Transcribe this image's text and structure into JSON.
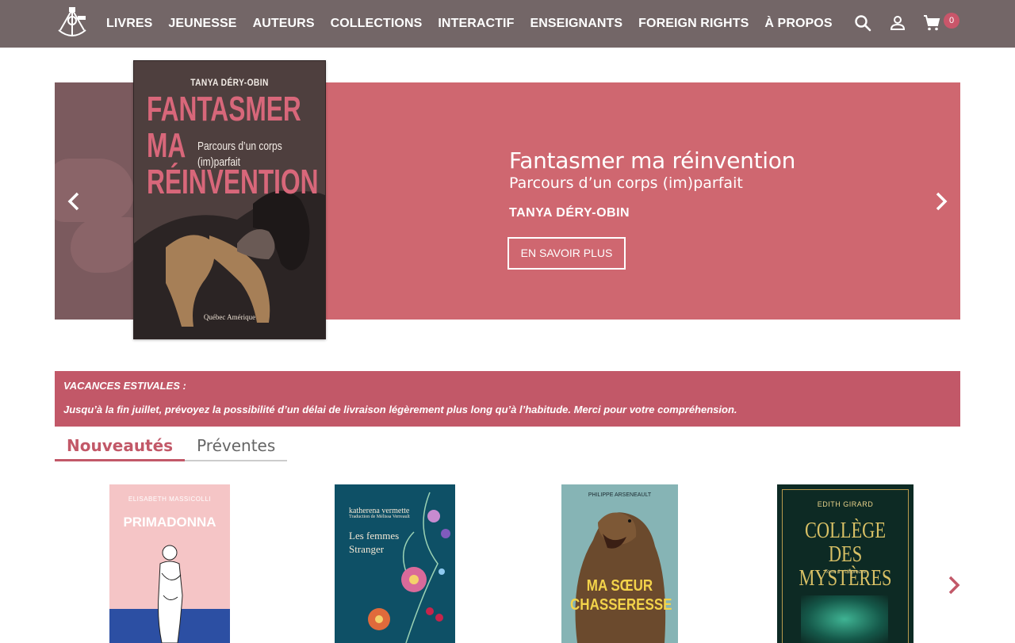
{
  "nav": {
    "items": [
      {
        "label": "LIVRES",
        "name": "nav-item-livres"
      },
      {
        "label": "JEUNESSE",
        "name": "nav-item-jeunesse"
      },
      {
        "label": "AUTEURS",
        "name": "nav-item-auteurs"
      },
      {
        "label": "COLLECTIONS",
        "name": "nav-item-collections"
      },
      {
        "label": "INTERACTIF",
        "name": "nav-item-interactif"
      },
      {
        "label": "ENSEIGNANTS",
        "name": "nav-item-enseignants"
      },
      {
        "label": "FOREIGN RIGHTS",
        "name": "nav-item-foreign-rights"
      },
      {
        "label": "À PROPOS",
        "name": "nav-item-a-propos"
      }
    ],
    "cart_count": "0"
  },
  "hero": {
    "title": "Fantasmer ma réinvention",
    "subtitle": "Parcours d’un corps (im)parfait",
    "author": "TANYA DÉRY-OBIN",
    "button_label": "EN SAVOIR PLUS",
    "cover": {
      "author": "TANYA DÉRY-OBIN",
      "title": "FANTASMER\nMA\nRÉINVENTION",
      "subtitle": "Parcours d’un corps\n(im)parfait",
      "publisher": "Québec Amérique"
    }
  },
  "notice": {
    "title": "VACANCES ESTIVALES :",
    "text": "Jusqu’à la fin juillet, prévoyez la possibilité d’un délai de livraison légèrement plus long qu’à l’habitude. Merci pour votre compréhension."
  },
  "tabs": [
    {
      "label": "Nouveautés",
      "active": true
    },
    {
      "label": "Préventes",
      "active": false
    }
  ],
  "books": [
    {
      "author": "ELISABETH MASSICOLLI",
      "title": "PRIMADONNA"
    },
    {
      "author": "katherena vermette",
      "translator": "Traduction de Mélissa Verreault",
      "title": "Les femmes Stranger"
    },
    {
      "author": "PHILIPPE ARSENEAULT",
      "title": "MA SŒUR\nCHASSERESSE"
    },
    {
      "author": "EDITH GIRARD",
      "title": "COLLÈGE\nDES\nMYSTÈRES",
      "tome": "Tome 1 - L'Épreuve"
    }
  ],
  "colors": {
    "nav_bg": "#736667",
    "hero_bg": "#cf6770",
    "accent": "#c25868",
    "notice_bg": "#c25868"
  }
}
